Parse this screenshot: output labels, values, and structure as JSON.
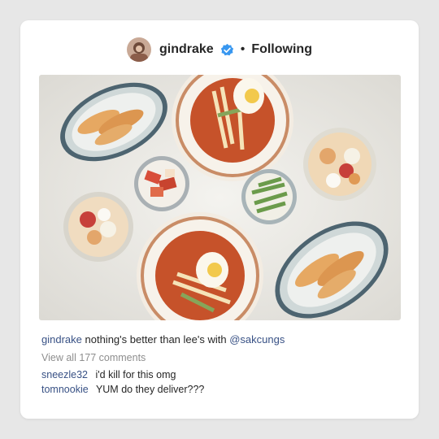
{
  "post": {
    "username": "gindrake",
    "verified_icon": "verified-badge-icon",
    "separator": "•",
    "follow_status": "Following",
    "accent_color": "#3897f0",
    "link_color": "#385185"
  },
  "caption": {
    "username": "gindrake",
    "text": "nothing's better than lee's with",
    "mention": "@sakcungs"
  },
  "comments": {
    "view_all_label": "View all 177 comments",
    "items": [
      {
        "user": "sneezle32",
        "text": "i'd kill for this omg"
      },
      {
        "user": "tomnookie",
        "text": "YUM do they deliver???"
      }
    ]
  }
}
